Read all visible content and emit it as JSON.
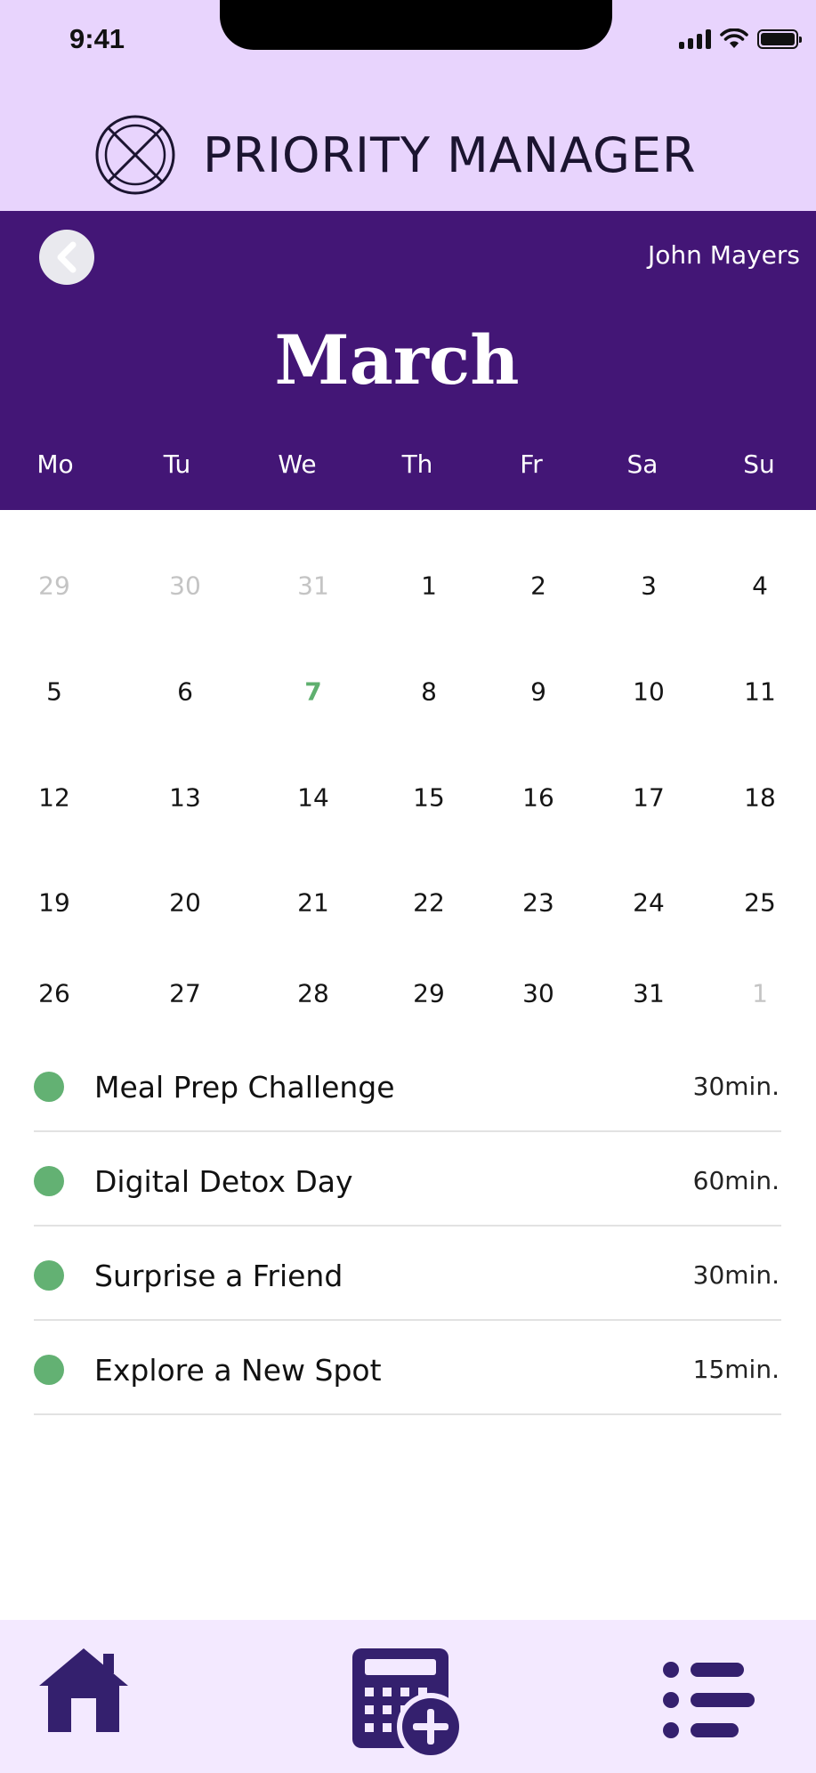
{
  "status_bar": {
    "time": "9:41"
  },
  "header": {
    "app_title": "PRIORITY MANAGER"
  },
  "calendar": {
    "user_name": "John Mayers",
    "month": "March",
    "weekdays": [
      "Mo",
      "Tu",
      "We",
      "Th",
      "Fr",
      "Sa",
      "Su"
    ],
    "weeks": [
      [
        {
          "d": "29",
          "s": "muted"
        },
        {
          "d": "30",
          "s": "muted"
        },
        {
          "d": "31",
          "s": "muted"
        },
        {
          "d": "1",
          "s": ""
        },
        {
          "d": "2",
          "s": ""
        },
        {
          "d": "3",
          "s": ""
        },
        {
          "d": "4",
          "s": ""
        }
      ],
      [
        {
          "d": "5",
          "s": ""
        },
        {
          "d": "6",
          "s": ""
        },
        {
          "d": "7",
          "s": "today"
        },
        {
          "d": "8",
          "s": ""
        },
        {
          "d": "9",
          "s": ""
        },
        {
          "d": "10",
          "s": ""
        },
        {
          "d": "11",
          "s": ""
        }
      ],
      [
        {
          "d": "12",
          "s": ""
        },
        {
          "d": "13",
          "s": ""
        },
        {
          "d": "14",
          "s": ""
        },
        {
          "d": "15",
          "s": ""
        },
        {
          "d": "16",
          "s": ""
        },
        {
          "d": "17",
          "s": ""
        },
        {
          "d": "18",
          "s": ""
        }
      ],
      [
        {
          "d": "19",
          "s": ""
        },
        {
          "d": "20",
          "s": ""
        },
        {
          "d": "21",
          "s": ""
        },
        {
          "d": "22",
          "s": ""
        },
        {
          "d": "23",
          "s": ""
        },
        {
          "d": "24",
          "s": ""
        },
        {
          "d": "25",
          "s": ""
        }
      ],
      [
        {
          "d": "26",
          "s": ""
        },
        {
          "d": "27",
          "s": ""
        },
        {
          "d": "28",
          "s": ""
        },
        {
          "d": "29",
          "s": ""
        },
        {
          "d": "30",
          "s": ""
        },
        {
          "d": "31",
          "s": ""
        },
        {
          "d": "1",
          "s": "muted"
        }
      ]
    ]
  },
  "tasks": [
    {
      "title": "Meal Prep Challenge",
      "duration": "30min."
    },
    {
      "title": "Digital Detox Day",
      "duration": "60min."
    },
    {
      "title": "Surprise a Friend",
      "duration": "30min."
    },
    {
      "title": "Explore a New Spot",
      "duration": "15min."
    }
  ],
  "nav": {
    "icons": [
      "home-icon",
      "calendar-add-icon",
      "list-icon"
    ]
  },
  "colors": {
    "header_bg": "#e8d4fd",
    "calendar_header_bg": "#431676",
    "today": "#5fb06f",
    "task_dot": "#63b173",
    "nav_bg": "#f3e9ff",
    "nav_icon": "#34206e"
  }
}
